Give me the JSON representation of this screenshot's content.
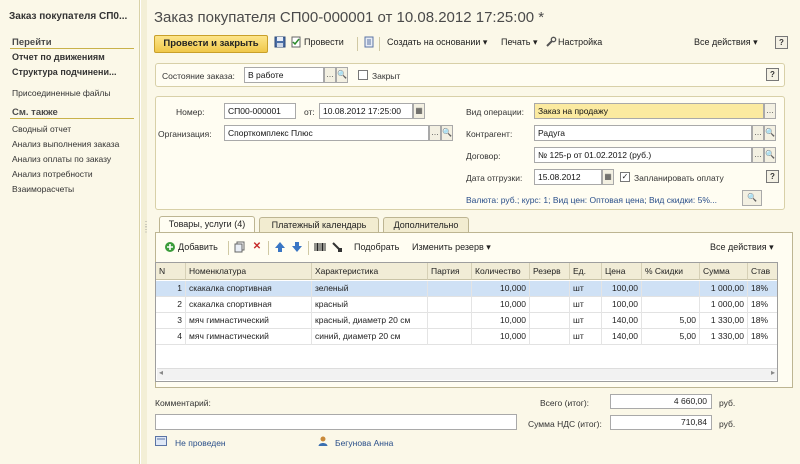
{
  "sidebar": {
    "title": "Заказ покупателя СП0...",
    "goto_header": "Перейти",
    "goto_items": [
      "Отчет по движениям",
      "Структура подчинени...",
      "Присоединенные файлы"
    ],
    "see_also_header": "См. также",
    "see_also_items": [
      "Сводный отчет",
      "Анализ выполнения заказа",
      "Анализ оплаты по заказу",
      "Анализ потребности",
      "Взаиморасчеты"
    ]
  },
  "header": {
    "title": "Заказ покупателя СП00-000001 от 10.08.2012 17:25:00 *"
  },
  "toolbar": {
    "post_close": "Провести и закрыть",
    "post": "Провести",
    "create_based": "Создать на основании",
    "print": "Печать",
    "settings": "Настройка",
    "all_actions": "Все действия"
  },
  "state": {
    "label": "Состояние заказа:",
    "value": "В работе",
    "closed_label": "Закрыт"
  },
  "doc": {
    "number_label": "Номер:",
    "number": "СП00-000001",
    "date_label": "от:",
    "date": "10.08.2012 17:25:00",
    "org_label": "Организация:",
    "org": "Спорткомплекс Плюс",
    "op_label": "Вид операции:",
    "op": "Заказ на продажу",
    "contractor_label": "Контрагент:",
    "contractor": "Радуга",
    "contract_label": "Договор:",
    "contract": "№ 125-р от 01.02.2012 (руб.)",
    "ship_label": "Дата отгрузки:",
    "ship_date": "15.08.2012",
    "plan_payment_label": "Запланировать оплату",
    "currency_info": "Валюта: руб.; курс: 1; Вид цен: Оптовая цена; Вид скидки: 5%..."
  },
  "tabs": [
    "Товары, услуги (4)",
    "Платежный календарь",
    "Дополнительно"
  ],
  "table_toolbar": {
    "add": "Добавить",
    "pick": "Подобрать",
    "change_reserve": "Изменить резерв",
    "all_actions": "Все действия"
  },
  "table": {
    "columns": [
      "N",
      "Номенклатура",
      "Характеристика",
      "Партия",
      "Количество",
      "Резерв",
      "Ед.",
      "Цена",
      "% Скидки",
      "Сумма",
      "Став"
    ],
    "rows": [
      [
        "1",
        "скакалка спортивная",
        "зеленый",
        "",
        "10,000",
        "",
        "шт",
        "100,00",
        "",
        "1 000,00",
        "18%"
      ],
      [
        "2",
        "скакалка спортивная",
        "красный",
        "",
        "10,000",
        "",
        "шт",
        "100,00",
        "",
        "1 000,00",
        "18%"
      ],
      [
        "3",
        "мяч гимнастический",
        "красный, диаметр 20 см",
        "",
        "10,000",
        "",
        "шт",
        "140,00",
        "5,00",
        "1 330,00",
        "18%"
      ],
      [
        "4",
        "мяч гимнастический",
        "синий, диаметр 20 см",
        "",
        "10,000",
        "",
        "шт",
        "140,00",
        "5,00",
        "1 330,00",
        "18%"
      ]
    ]
  },
  "footer": {
    "comment_label": "Комментарий:",
    "total_label": "Всего (итог):",
    "total": "4 660,00",
    "total_cur": "руб.",
    "vat_label": "Сумма НДС (итог):",
    "vat": "710,84",
    "vat_cur": "руб.",
    "status": "Не проведен",
    "user": "Бегунова Анна"
  },
  "colors": {
    "accent": "#f0c84a",
    "selection": "#cfe1f5",
    "background": "#fbf8e8"
  }
}
